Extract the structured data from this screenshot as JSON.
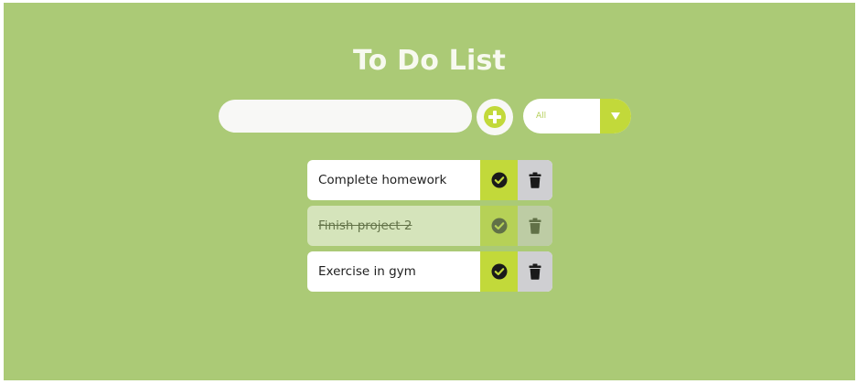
{
  "app": {
    "title": "To Do List"
  },
  "input": {
    "value": "",
    "placeholder": ""
  },
  "add_button": {
    "icon": "plus-circle-icon"
  },
  "filter": {
    "selected": "All",
    "icon": "caret-down-icon"
  },
  "todos": [
    {
      "text": "Complete homework",
      "completed": false
    },
    {
      "text": "Finish project 2",
      "completed": true
    },
    {
      "text": "Exercise in gym",
      "completed": false
    }
  ],
  "colors": {
    "background": "#abca76",
    "accent": "#c2d93a",
    "delete": "#cfcfd2",
    "title": "#f7f9ef",
    "text": "#1e1e1e"
  }
}
